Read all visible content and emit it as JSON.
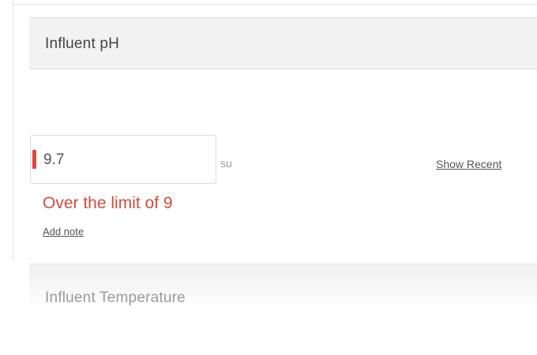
{
  "sections": [
    {
      "title": "Influent pH",
      "value": "9.7",
      "unit": "su",
      "show_recent_label": "Show Recent",
      "error_message": "Over the limit of 9",
      "add_note_label": "Add note"
    },
    {
      "title": "Influent Temperature"
    }
  ],
  "colors": {
    "alert": "#e04545",
    "error_text": "#d14b3e"
  }
}
